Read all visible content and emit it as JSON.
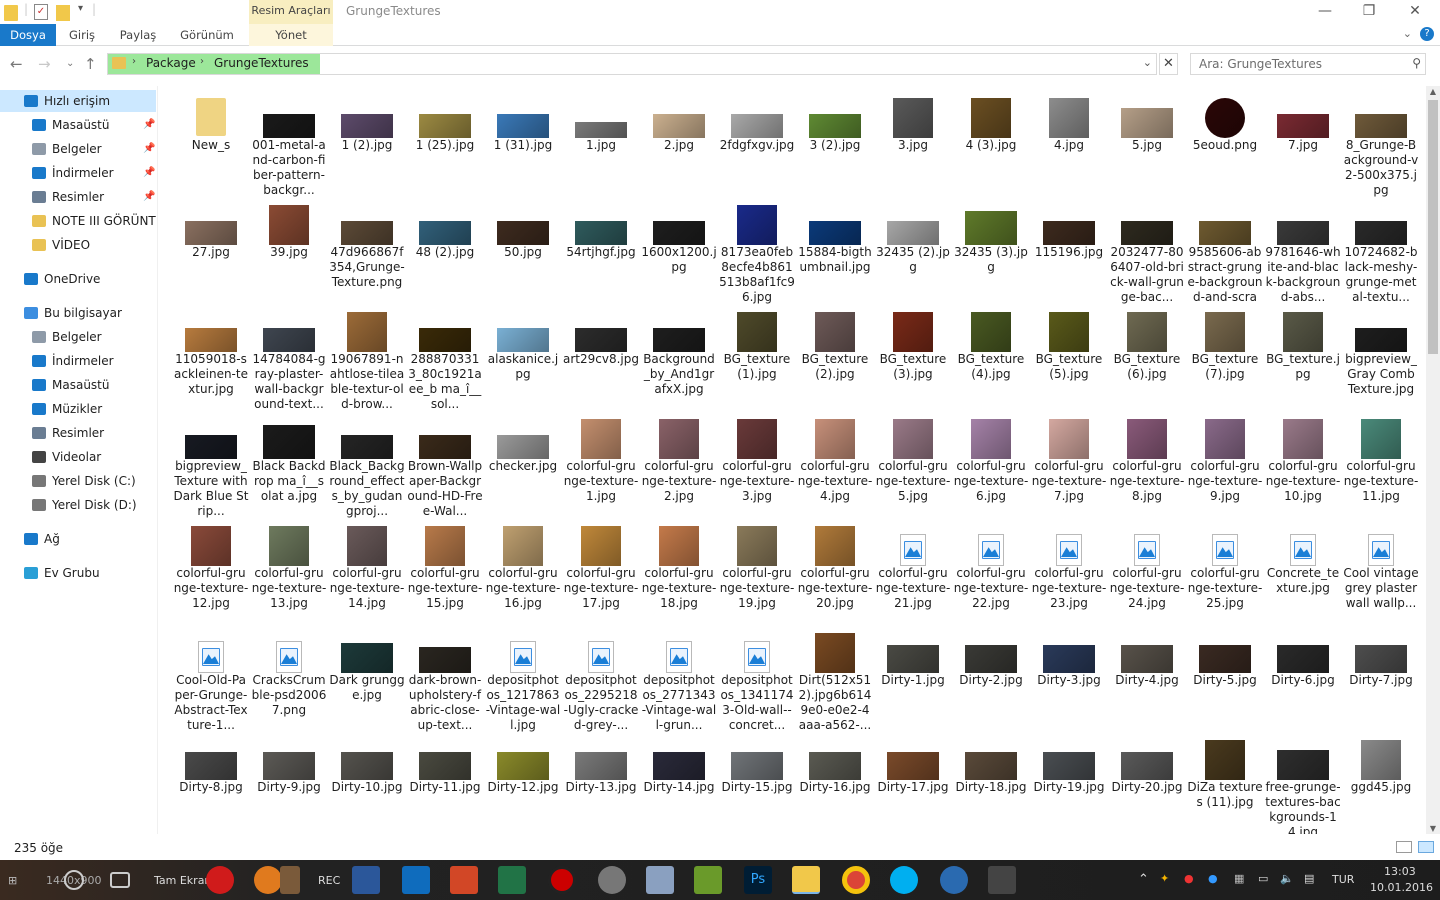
{
  "window": {
    "context_group": "Resim Araçları",
    "title": "GrungeTextures",
    "minimize": "—",
    "maximize": "❐",
    "close": "✕"
  },
  "ribbon": {
    "tabs": [
      "Dosya",
      "Giriş",
      "Paylaş",
      "Görünüm",
      "Yönet"
    ]
  },
  "address": {
    "crumbs": [
      "Package",
      "GrungeTextures"
    ],
    "search_placeholder": "Ara: GrungeTextures"
  },
  "sidebar": {
    "items": [
      {
        "label": "Hızlı erişim",
        "icon": "star-icon",
        "color": "#1979ca",
        "pinned": false,
        "selected": true,
        "indent": 1
      },
      {
        "label": "Masaüstü",
        "icon": "desktop-icon",
        "color": "#1979ca",
        "pinned": true,
        "indent": 2
      },
      {
        "label": "Belgeler",
        "icon": "document-icon",
        "color": "#8e9aa8",
        "pinned": true,
        "indent": 2
      },
      {
        "label": "İndirmeler",
        "icon": "download-icon",
        "color": "#1979ca",
        "pinned": true,
        "indent": 2
      },
      {
        "label": "Resimler",
        "icon": "pictures-icon",
        "color": "#6a7d93",
        "pinned": true,
        "indent": 2
      },
      {
        "label": "NOTE III GÖRÜNTÜ",
        "icon": "folder-icon",
        "color": "#e9c254",
        "pinned": false,
        "indent": 2
      },
      {
        "label": "VİDEO",
        "icon": "folder-icon",
        "color": "#e9c254",
        "pinned": false,
        "indent": 2
      },
      {
        "label": "OneDrive",
        "icon": "cloud-icon",
        "color": "#1979ca",
        "pinned": false,
        "indent": 1,
        "gap": true
      },
      {
        "label": "Bu bilgisayar",
        "icon": "computer-icon",
        "color": "#3c8ee0",
        "pinned": false,
        "indent": 1,
        "gap": true
      },
      {
        "label": "Belgeler",
        "icon": "document-icon",
        "color": "#8e9aa8",
        "pinned": false,
        "indent": 2
      },
      {
        "label": "İndirmeler",
        "icon": "download-icon",
        "color": "#1979ca",
        "pinned": false,
        "indent": 2
      },
      {
        "label": "Masaüstü",
        "icon": "desktop-icon",
        "color": "#1979ca",
        "pinned": false,
        "indent": 2
      },
      {
        "label": "Müzikler",
        "icon": "music-icon",
        "color": "#1979ca",
        "pinned": false,
        "indent": 2
      },
      {
        "label": "Resimler",
        "icon": "pictures-icon",
        "color": "#6a7d93",
        "pinned": false,
        "indent": 2
      },
      {
        "label": "Videolar",
        "icon": "video-icon",
        "color": "#444",
        "pinned": false,
        "indent": 2
      },
      {
        "label": "Yerel Disk (C:)",
        "icon": "drive-icon",
        "color": "#777",
        "pinned": false,
        "indent": 2
      },
      {
        "label": "Yerel Disk (D:)",
        "icon": "drive-icon",
        "color": "#777",
        "pinned": false,
        "indent": 2
      },
      {
        "label": "Ağ",
        "icon": "network-icon",
        "color": "#1979ca",
        "pinned": false,
        "indent": 1,
        "gap": true
      },
      {
        "label": "Ev Grubu",
        "icon": "homegroup-icon",
        "color": "#2a9fd6",
        "pinned": false,
        "indent": 1,
        "gap": true
      }
    ]
  },
  "files": [
    {
      "name": "New_s",
      "t": "folder"
    },
    {
      "name": "001-metal-and-carbon-fiber-pattern-backgr...",
      "c": "#1a1a1a"
    },
    {
      "name": "1 (2).jpg",
      "c": "#5d4b6b"
    },
    {
      "name": "1 (25).jpg",
      "c": "#9c8a42"
    },
    {
      "name": "1 (31).jpg",
      "c": "#3a79b8"
    },
    {
      "name": "1.jpg",
      "c": "#7a7a7a",
      "h": 16
    },
    {
      "name": "2.jpg",
      "c": "#cbb08f"
    },
    {
      "name": "2fdgfxgv.jpg",
      "c": "#a9a9a9"
    },
    {
      "name": "3 (2).jpg",
      "c": "#5f8a33"
    },
    {
      "name": "3.jpg",
      "c": "#5a5a5a",
      "h": 40
    },
    {
      "name": "4 (3).jpg",
      "c": "#6b4f22",
      "h": 40
    },
    {
      "name": "4.jpg",
      "c": "#8d8d8d",
      "h": 40
    },
    {
      "name": "5.jpg",
      "c": "#b59f88",
      "h": 30
    },
    {
      "name": "5eoud.png",
      "c": "#2b0707",
      "h": 40,
      "round": true
    },
    {
      "name": "7.jpg",
      "c": "#7a2a32"
    },
    {
      "name": "8_Grunge-Background-v2-500x375.jpg",
      "c": "#6f5a3a"
    },
    {
      "name": "27.jpg",
      "c": "#8a7060"
    },
    {
      "name": "39.jpg",
      "c": "#8b4b34",
      "h": 40
    },
    {
      "name": "47d966867f354,Grunge-Texture.png",
      "c": "#5c4a37"
    },
    {
      "name": "48 (2).jpg",
      "c": "#31607a"
    },
    {
      "name": "50.jpg",
      "c": "#3e2b1f"
    },
    {
      "name": "54rtjhgf.jpg",
      "c": "#2f5b5d"
    },
    {
      "name": "1600x1200.jpg",
      "c": "#1e1e1e"
    },
    {
      "name": "8173ea0feb8ecfe4b861513b8af1fc96.jpg",
      "c": "#1a2a8a",
      "h": 40
    },
    {
      "name": "15884-bigthumbnail.jpg",
      "c": "#0b3a7a"
    },
    {
      "name": "32435 (2).jpg",
      "c": "#a7a7a7"
    },
    {
      "name": "32435 (3).jpg",
      "c": "#5f7a2a",
      "h": 34
    },
    {
      "name": "115196.jpg",
      "c": "#3d2a1e"
    },
    {
      "name": "2032477-806407-old-brick-wall-grunge-bac...",
      "c": "#2e2a1f"
    },
    {
      "name": "9585606-abstract-grunge-background-and-scrat...",
      "c": "#6e5a30"
    },
    {
      "name": "9781646-white-and-black-background-abs...",
      "c": "#3a3a3a"
    },
    {
      "name": "10724682-black-meshy-grunge-metal-textu...",
      "c": "#2a2a2a"
    },
    {
      "name": "11059018-sackleinen-textur.jpg",
      "c": "#b77b3e"
    },
    {
      "name": "14784084-gray-plaster-wall-background-text...",
      "c": "#3f4650"
    },
    {
      "name": "19067891-nahtlose-tileable-textur-old-brow...",
      "c": "#9c6b38",
      "h": 40
    },
    {
      "name": "2888703313_80c1921aee_b ma_î__sol...",
      "c": "#3a2a08"
    },
    {
      "name": "alaskanice.jpg",
      "c": "#7ab0d4"
    },
    {
      "name": "art29cv8.jpg",
      "c": "#2c2c2c"
    },
    {
      "name": "Background_by_And1grafxX.jpg",
      "c": "#1e1e1e"
    },
    {
      "name": "BG_texture (1).jpg",
      "c": "#4f4a2a",
      "h": 40
    },
    {
      "name": "BG_texture (2).jpg",
      "c": "#6e5a58",
      "h": 40
    },
    {
      "name": "BG_texture (3).jpg",
      "c": "#7a2a18",
      "h": 40
    },
    {
      "name": "BG_texture (4).jpg",
      "c": "#4a5a22",
      "h": 40
    },
    {
      "name": "BG_texture (5).jpg",
      "c": "#5a5a1a",
      "h": 40
    },
    {
      "name": "BG_texture (6).jpg",
      "c": "#6f6a52",
      "h": 40
    },
    {
      "name": "BG_texture (7).jpg",
      "c": "#7a6a4e",
      "h": 40
    },
    {
      "name": "BG_texture.jpg",
      "c": "#5a5a48",
      "h": 40
    },
    {
      "name": "bigpreview_Gray Comb Texture.jpg",
      "c": "#1e1e1e"
    },
    {
      "name": "bigpreview_Texture with Dark Blue Strip...",
      "c": "#171a22"
    },
    {
      "name": "Black Backdrop ma_î__solat a.jpg",
      "c": "#1b1b1b",
      "h": 34
    },
    {
      "name": "Black_Background_effects_by_gudangproj...",
      "c": "#252525"
    },
    {
      "name": "Brown-Wallpaper-Background-HD-Free-Wal...",
      "c": "#3a2a1a"
    },
    {
      "name": "checker.jpg",
      "c": "#9a9a9a"
    },
    {
      "name": "colorful-grunge-texture-1.jpg",
      "c": "#c48f6e",
      "h": 40
    },
    {
      "name": "colorful-grunge-texture-2.jpg",
      "c": "#8a6268",
      "h": 40
    },
    {
      "name": "colorful-grunge-texture-3.jpg",
      "c": "#6a3a3a",
      "h": 40
    },
    {
      "name": "colorful-grunge-texture-4.jpg",
      "c": "#c7907a",
      "h": 40
    },
    {
      "name": "colorful-grunge-texture-5.jpg",
      "c": "#9a7a88",
      "h": 40
    },
    {
      "name": "colorful-grunge-texture-6.jpg",
      "c": "#a582a8",
      "h": 40
    },
    {
      "name": "colorful-grunge-texture-7.jpg",
      "c": "#d4a8a0",
      "h": 40
    },
    {
      "name": "colorful-grunge-texture-8.jpg",
      "c": "#8a5a7a",
      "h": 40
    },
    {
      "name": "colorful-grunge-texture-9.jpg",
      "c": "#8a6a8a",
      "h": 40
    },
    {
      "name": "colorful-grunge-texture-10.jpg",
      "c": "#9a7a8a",
      "h": 40
    },
    {
      "name": "colorful-grunge-texture-11.jpg",
      "c": "#4a8a7a",
      "h": 40
    },
    {
      "name": "colorful-grunge-texture-12.jpg",
      "c": "#8a4a3a",
      "h": 40
    },
    {
      "name": "colorful-grunge-texture-13.jpg",
      "c": "#6e7a5e",
      "h": 40
    },
    {
      "name": "colorful-grunge-texture-14.jpg",
      "c": "#6a5a5a",
      "h": 40
    },
    {
      "name": "colorful-grunge-texture-15.jpg",
      "c": "#b87a4a",
      "h": 40
    },
    {
      "name": "colorful-grunge-texture-16.jpg",
      "c": "#bfa070",
      "h": 40
    },
    {
      "name": "colorful-grunge-texture-17.jpg",
      "c": "#c0883a",
      "h": 40
    },
    {
      "name": "colorful-grunge-texture-18.jpg",
      "c": "#c47a4a",
      "h": 40
    },
    {
      "name": "colorful-grunge-texture-19.jpg",
      "c": "#8a7a5a",
      "h": 40
    },
    {
      "name": "colorful-grunge-texture-20.jpg",
      "c": "#b07a3a",
      "h": 40
    },
    {
      "name": "colorful-grunge-texture-21.jpg",
      "t": "generic"
    },
    {
      "name": "colorful-grunge-texture-22.jpg",
      "t": "generic"
    },
    {
      "name": "colorful-grunge-texture-23.jpg",
      "t": "generic"
    },
    {
      "name": "colorful-grunge-texture-24.jpg",
      "t": "generic"
    },
    {
      "name": "colorful-grunge-texture-25.jpg",
      "t": "generic"
    },
    {
      "name": "Concrete_texture.jpg",
      "t": "generic"
    },
    {
      "name": "Cool vintage grey plaster wall wallp...",
      "t": "generic"
    },
    {
      "name": "Cool-Old-Paper-Grunge-Abstract-Texture-1...",
      "t": "generic"
    },
    {
      "name": "CracksCrumble-psd20067.png",
      "t": "generic"
    },
    {
      "name": "Dark grungge.jpg",
      "c": "#1d3a3a",
      "h": 30
    },
    {
      "name": "dark-brown-upholstery-fabric-close-up-text...",
      "c": "#2a2620",
      "h": 26
    },
    {
      "name": "depositphotos_1217863-Vintage-wall.jpg",
      "t": "generic"
    },
    {
      "name": "depositphotos_2295218-Ugly-cracked-grey-...",
      "t": "generic"
    },
    {
      "name": "depositphotos_2771343-Vintage-wall-grun...",
      "t": "generic"
    },
    {
      "name": "depositphotos_13411743-Old-wall--concret...",
      "t": "generic"
    },
    {
      "name": "Dirt(512x512).jpg6b6149e0-e0e2-4aaa-a562-...",
      "c": "#7a4a22",
      "h": 40
    },
    {
      "name": "Dirty-1.jpg",
      "c": "#4a4a44",
      "h": 28
    },
    {
      "name": "Dirty-2.jpg",
      "c": "#3a3a36",
      "h": 28
    },
    {
      "name": "Dirty-3.jpg",
      "c": "#2a3a5a",
      "h": 28
    },
    {
      "name": "Dirty-4.jpg",
      "c": "#58524a",
      "h": 28
    },
    {
      "name": "Dirty-5.jpg",
      "c": "#3a2a22",
      "h": 28
    },
    {
      "name": "Dirty-6.jpg",
      "c": "#2a2a2a",
      "h": 28
    },
    {
      "name": "Dirty-7.jpg",
      "c": "#4e4e4e",
      "h": 28
    },
    {
      "name": "Dirty-8.jpg",
      "c": "#4a4a4a",
      "h": 28
    },
    {
      "name": "Dirty-9.jpg",
      "c": "#5c5a56",
      "h": 28
    },
    {
      "name": "Dirty-10.jpg",
      "c": "#55534e",
      "h": 28
    },
    {
      "name": "Dirty-11.jpg",
      "c": "#4a4a40",
      "h": 28
    },
    {
      "name": "Dirty-12.jpg",
      "c": "#8a8a2a",
      "h": 28
    },
    {
      "name": "Dirty-13.jpg",
      "c": "#7a7a7a",
      "h": 28
    },
    {
      "name": "Dirty-14.jpg",
      "c": "#2a2a3a",
      "h": 28
    },
    {
      "name": "Dirty-15.jpg",
      "c": "#707478",
      "h": 28
    },
    {
      "name": "Dirty-16.jpg",
      "c": "#5a5a52",
      "h": 28
    },
    {
      "name": "Dirty-17.jpg",
      "c": "#7a4a2a",
      "h": 28
    },
    {
      "name": "Dirty-18.jpg",
      "c": "#5a4a3a",
      "h": 28
    },
    {
      "name": "Dirty-19.jpg",
      "c": "#4a4e52",
      "h": 28
    },
    {
      "name": "Dirty-20.jpg",
      "c": "#5a5a5a",
      "h": 28
    },
    {
      "name": "DiZa textures (11).jpg",
      "c": "#4a3a1e",
      "h": 40
    },
    {
      "name": "free-grunge-textures-backgrounds-14.jpg",
      "c": "#2e2e2e",
      "h": 30
    },
    {
      "name": "ggd45.jpg",
      "c": "#8a8a8a",
      "h": 40
    }
  ],
  "status": {
    "count": "235 öğe"
  },
  "taskbar": {
    "left_text": "1440x900",
    "app_label": "Tam Ekran",
    "rec": "REC",
    "lang": "TUR",
    "time": "13:03",
    "date": "10.01.2016"
  }
}
